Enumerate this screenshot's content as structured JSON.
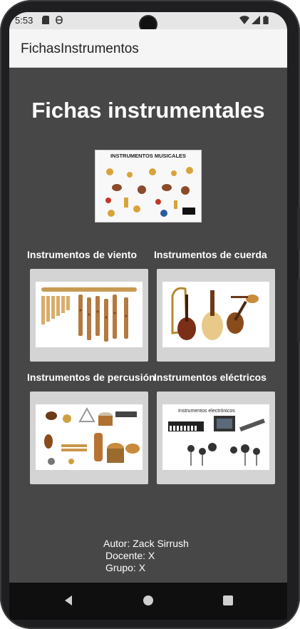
{
  "status_bar": {
    "time": "5:53",
    "icons": [
      "sd-card-icon",
      "a11y-icon",
      "wifi-icon",
      "signal-icon",
      "battery-icon"
    ]
  },
  "app_bar": {
    "title": "FichasInstrumentos"
  },
  "main": {
    "heading": "Fichas instrumentales",
    "poster": {
      "caption": "INSTRUMENTOS MUSICALES"
    },
    "categories": [
      {
        "label": "Instrumentos de viento",
        "image": "wind-instruments-image"
      },
      {
        "label": "Instrumentos de cuerda",
        "image": "string-instruments-image"
      },
      {
        "label": "Instrumentos de percusión",
        "image": "percussion-instruments-image"
      },
      {
        "label": "Instrumentos eléctricos",
        "image": "electric-instruments-image",
        "image_caption": "Instrumentos electrónicos"
      }
    ]
  },
  "footer": {
    "author": "Autor: Zack Sirrush",
    "teacher": "Docente: X",
    "group": "Grupo: X"
  },
  "nav_bar": {
    "buttons": [
      "back-icon",
      "home-icon",
      "recents-icon"
    ]
  },
  "colors": {
    "background": "#474747",
    "app_bar": "#f5f5f5",
    "card": "#d4d4d4",
    "text_light": "#ffffff"
  }
}
